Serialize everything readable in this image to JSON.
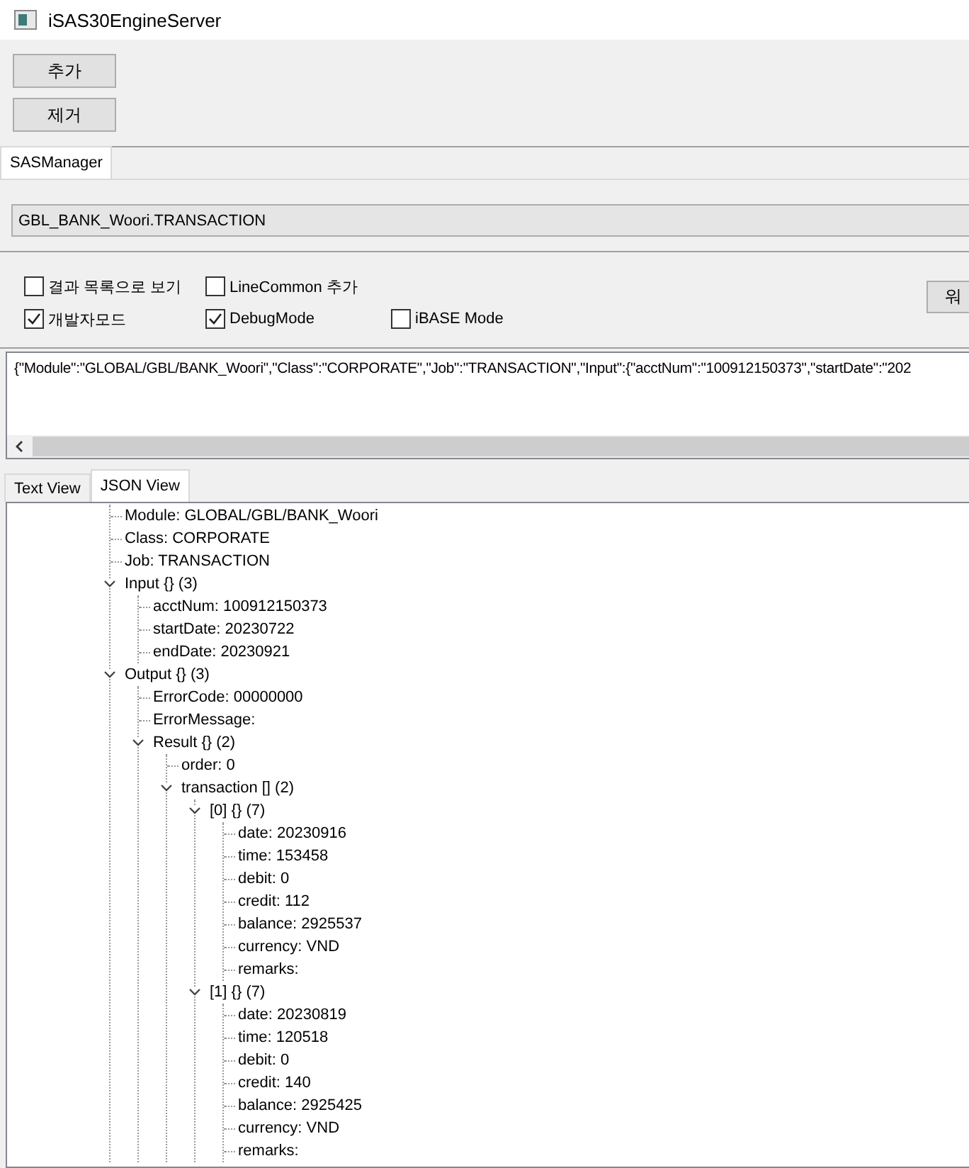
{
  "window": {
    "title": "iSAS30EngineServer"
  },
  "toolbar": {
    "buttons": [
      "추가",
      "제거"
    ]
  },
  "tabs": [
    {
      "label": "SASManager",
      "selected": true
    }
  ],
  "job_selector": {
    "value": "GBL_BANK_Woori.TRANSACTION"
  },
  "option_rows": [
    [
      {
        "label": "결과 목록으로 보기",
        "checked": false
      },
      {
        "label": "LineCommon 추가",
        "checked": false
      }
    ],
    [
      {
        "label": "개발자모드",
        "checked": true
      },
      {
        "label": "DebugMode",
        "checked": true
      },
      {
        "label": "iBASE Mode",
        "checked": false
      }
    ]
  ],
  "side_button": {
    "label": "워"
  },
  "request_text": {
    "value": "{\"Module\":\"GLOBAL/GBL/BANK_Woori\",\"Class\":\"CORPORATE\",\"Job\":\"TRANSACTION\",\"Input\":{\"acctNum\":\"100912150373\",\"startDate\":\"202"
  },
  "view_tabs": [
    {
      "label": "Text View",
      "selected": false
    },
    {
      "label": "JSON View",
      "selected": true
    }
  ],
  "tree": {
    "nodes": [
      {
        "label": "Module: GLOBAL/GBL/BANK_Woori"
      },
      {
        "label": "Class: CORPORATE"
      },
      {
        "label": "Job: TRANSACTION"
      },
      {
        "label": "Input {} (3)",
        "expanded": true,
        "children": [
          {
            "label": "acctNum: 100912150373"
          },
          {
            "label": "startDate: 20230722"
          },
          {
            "label": "endDate: 20230921"
          }
        ]
      },
      {
        "label": "Output {} (3)",
        "expanded": true,
        "children": [
          {
            "label": "ErrorCode: 00000000"
          },
          {
            "label": "ErrorMessage:"
          },
          {
            "label": "Result {} (2)",
            "expanded": true,
            "children": [
              {
                "label": "order: 0"
              },
              {
                "label": "transaction [] (2)",
                "expanded": true,
                "children": [
                  {
                    "label": "[0] {} (7)",
                    "expanded": true,
                    "children": [
                      {
                        "label": "date: 20230916"
                      },
                      {
                        "label": "time: 153458"
                      },
                      {
                        "label": "debit: 0"
                      },
                      {
                        "label": "credit: 112"
                      },
                      {
                        "label": "balance: 2925537"
                      },
                      {
                        "label": "currency: VND"
                      },
                      {
                        "label": "remarks:"
                      }
                    ]
                  },
                  {
                    "label": "[1] {} (7)",
                    "expanded": true,
                    "children": [
                      {
                        "label": "date: 20230819"
                      },
                      {
                        "label": "time: 120518"
                      },
                      {
                        "label": "debit: 0"
                      },
                      {
                        "label": "credit: 140"
                      },
                      {
                        "label": "balance: 2925425"
                      },
                      {
                        "label": "currency: VND"
                      },
                      {
                        "label": "remarks:"
                      }
                    ]
                  }
                ]
              }
            ]
          }
        ]
      }
    ]
  }
}
